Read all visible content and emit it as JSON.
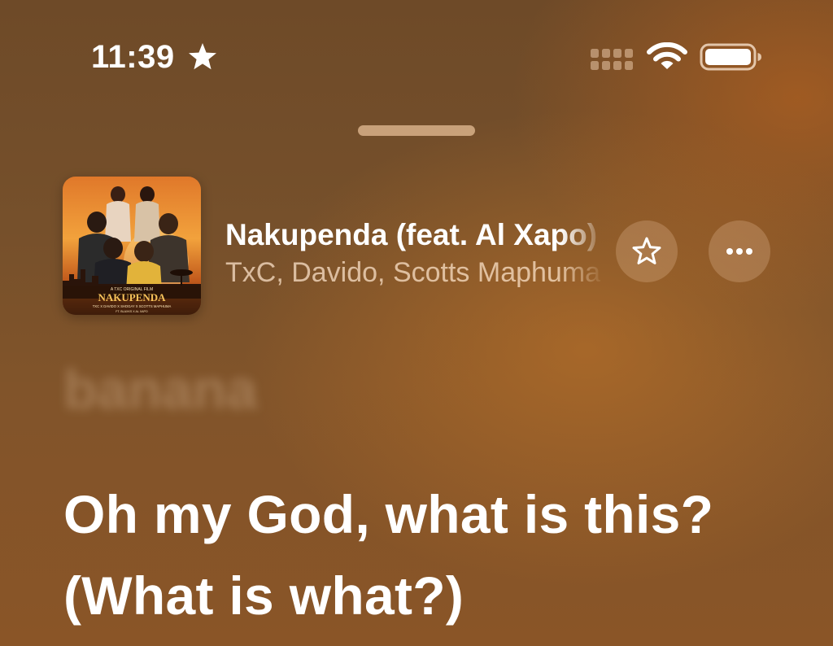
{
  "status_bar": {
    "time": "11:39",
    "time_icon": "star-icon",
    "signal_icon": "cellular-dots-icon",
    "wifi_icon": "wifi-icon",
    "battery_icon": "battery-full-icon"
  },
  "sheet": {
    "grabber_icon": "grabber-handle"
  },
  "now_playing": {
    "artwork": {
      "tagline": "A TXC ORIGINAL FILM",
      "title": "NAKUPENDA",
      "credits": "TXC X DAVIDO X SHOGAY X SCOTTS MAPHUMA",
      "featuring": "FT. BLAXKS X AL XAPO"
    },
    "title": "Nakupenda (feat. Al Xapo)",
    "artist": "TxC, Davido, Scotts Maphuma",
    "favorite_icon": "star-outline-icon",
    "more_icon": "ellipsis-icon"
  },
  "lyrics": {
    "previous_line": "banana",
    "current_line": "Oh my God, what is this? (What is what?)"
  },
  "colors": {
    "background_top": "#6e4a28",
    "background_bottom": "#8a5527",
    "text_primary": "#ffffff",
    "text_secondary": "#f0d2b4"
  }
}
